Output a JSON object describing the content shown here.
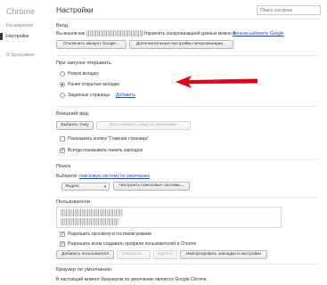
{
  "sidebar": {
    "brand": "Chrome",
    "items": [
      {
        "label": "Расширения"
      },
      {
        "label": "Настройки"
      },
      {
        "label": "О программе"
      }
    ]
  },
  "header": {
    "title": "Настройки",
    "search_placeholder": "Поиск настроек"
  },
  "signin": {
    "title": "Вход",
    "text": "Вы вошли как",
    "text_after": "Управлять синхронизацией данных можно в",
    "link": "Личном кабинете Google",
    "buttons": [
      "Отключить аккаунт Google...",
      "Дополнительные настройки синхронизации..."
    ]
  },
  "startup": {
    "title": "При запуске открывать",
    "options": [
      {
        "label": "Новую вкладку",
        "checked": false
      },
      {
        "label": "Ранее открытые вкладки",
        "checked": true
      },
      {
        "label": "Заданные страницы",
        "checked": false
      }
    ],
    "add_link": "Добавить"
  },
  "appearance": {
    "title": "Внешний вид",
    "theme_button": "Выбрать тему",
    "reset_button": "Восстановить тему по умолчанию",
    "checkboxes": [
      {
        "label": "Показывать кнопку \"Главная страница\"",
        "checked": false
      },
      {
        "label": "Всегда показывать панель закладок",
        "checked": true
      }
    ]
  },
  "search": {
    "title": "Поиск",
    "text": "Выберите",
    "link": "поисковую систему по умолчанию",
    "engine": "Яндекс",
    "manage_button": "Настроить поисковые системы..."
  },
  "users": {
    "title": "Пользователи",
    "checkboxes": [
      {
        "label": "Разрешить просмотр в гостевом режиме",
        "checked": true
      },
      {
        "label": "Разрешить всем создавать профили пользователей в Chrome",
        "checked": true
      }
    ],
    "buttons": [
      {
        "label": "Добавить пользователя",
        "disabled": false
      },
      {
        "label": "Изменить...",
        "disabled": true
      },
      {
        "label": "Удалить",
        "disabled": true
      },
      {
        "label": "Импортировать закладки и настройки",
        "disabled": false
      }
    ]
  },
  "default_browser": {
    "title": "Браузер по умолчанию",
    "text": "В настоящий момент браузером по умолчанию является Google Chrome."
  },
  "colors": {
    "arrow": "#e2001a",
    "link": "#1155cc"
  }
}
